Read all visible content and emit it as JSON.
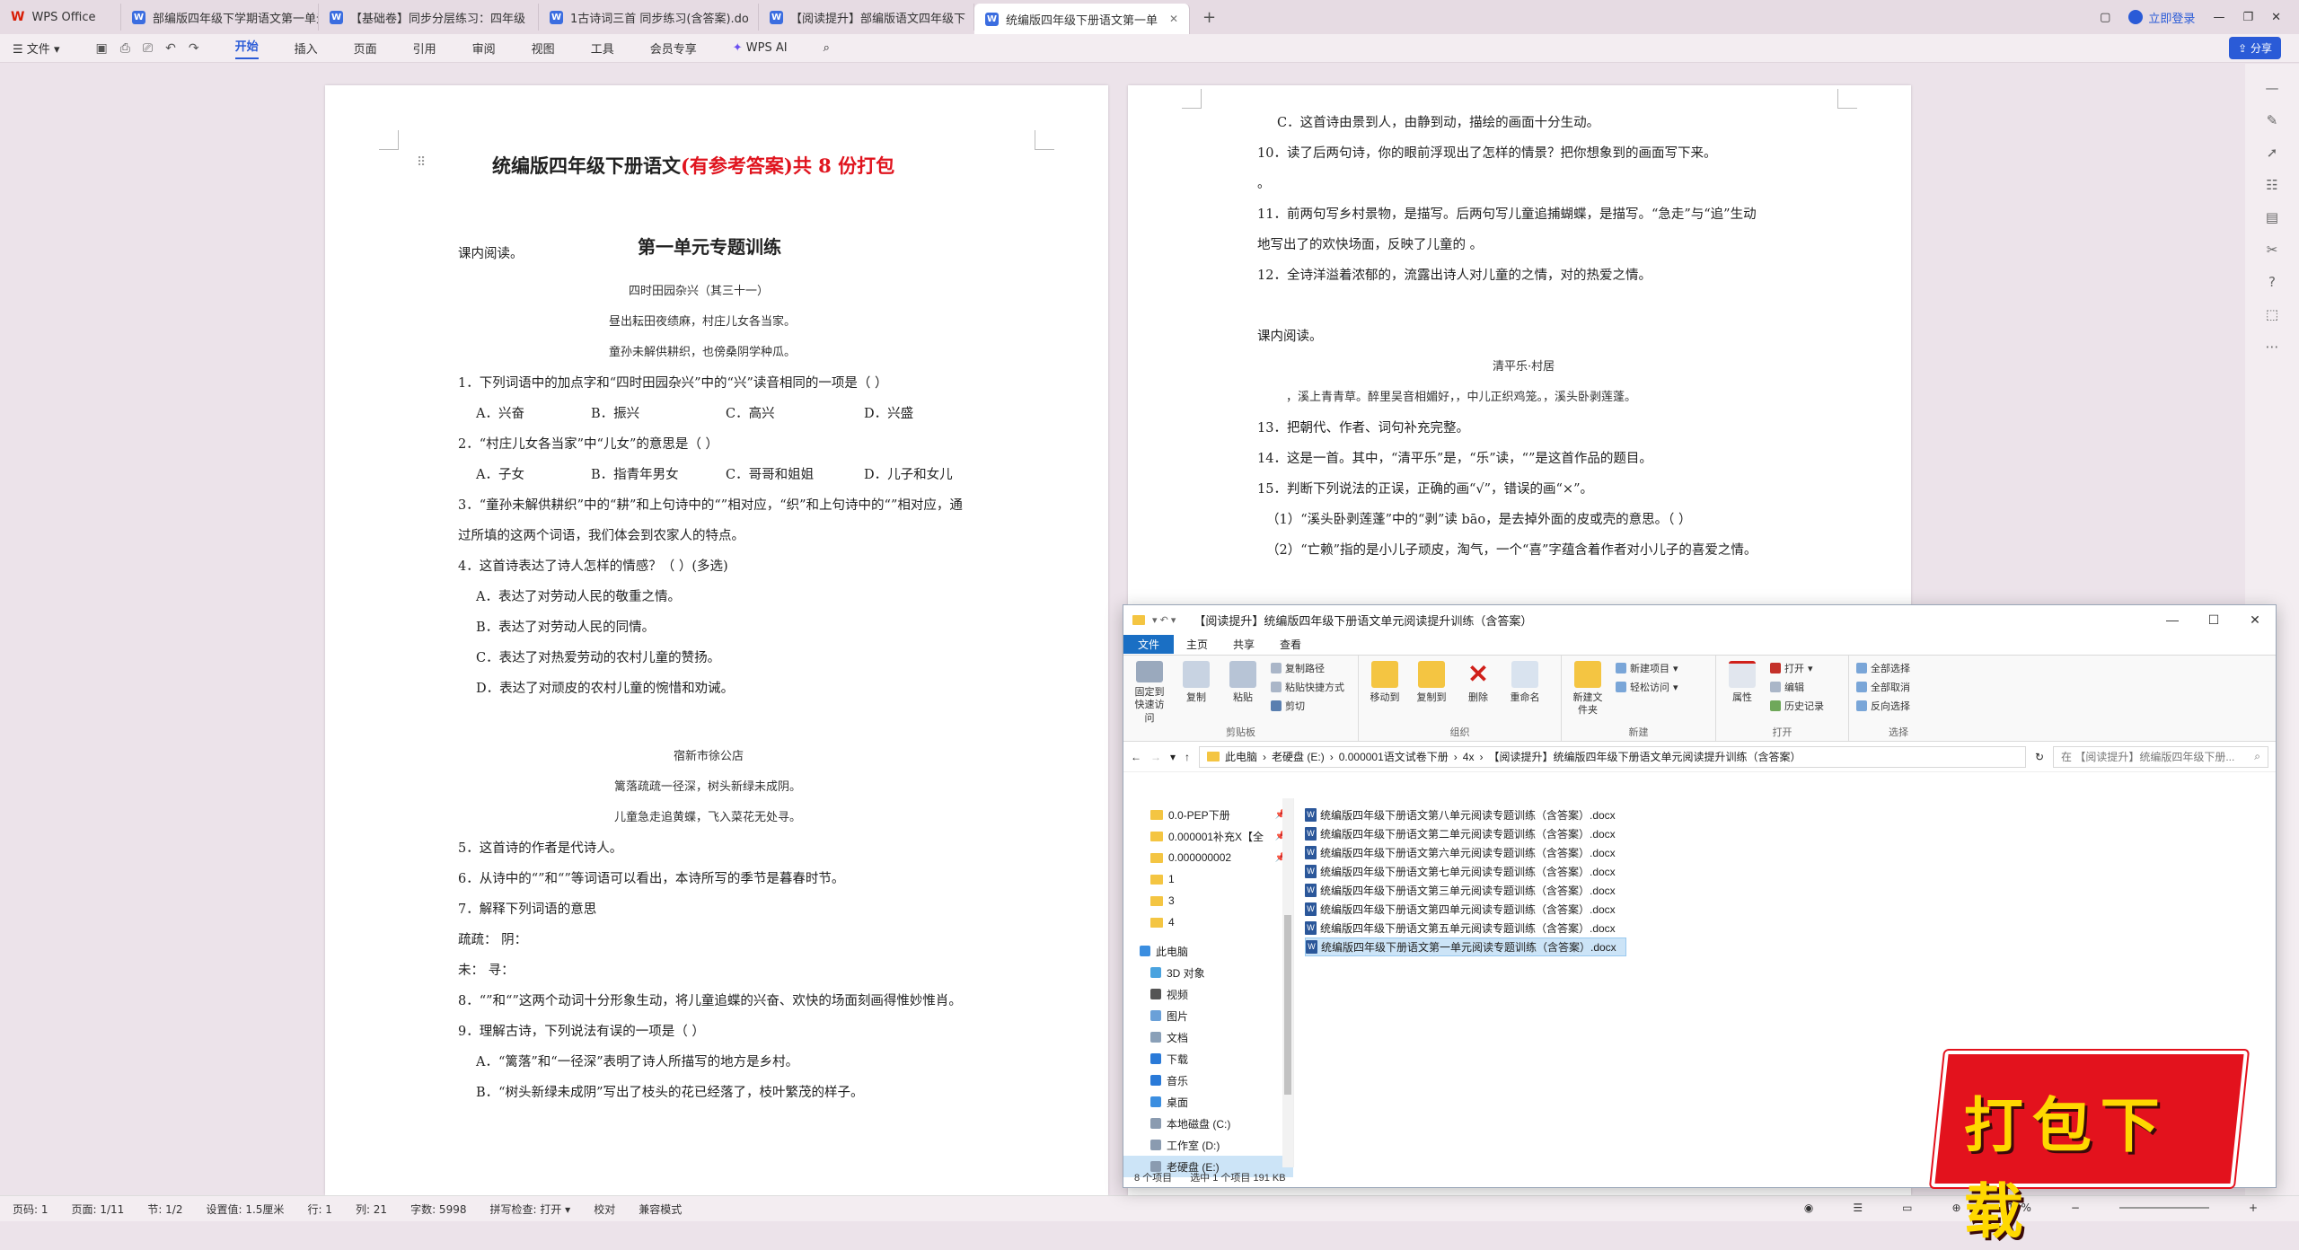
{
  "tabs": [
    {
      "label": "WPS Office",
      "type": "home"
    },
    {
      "label": "部编版四年级下学期语文第一单元",
      "type": "doc"
    },
    {
      "label": "【基础卷】同步分层练习：四年级",
      "type": "doc"
    },
    {
      "label": "1古诗词三首 同步练习(含答案).do",
      "type": "doc"
    },
    {
      "label": "【阅读提升】部编版语文四年级下",
      "type": "doc"
    },
    {
      "label": "统编版四年级下册语文第一单",
      "type": "doc",
      "active": true
    }
  ],
  "login": "立即登录",
  "menu": {
    "file": "文件",
    "items": [
      "开始",
      "插入",
      "页面",
      "引用",
      "审阅",
      "视图",
      "工具",
      "会员专享"
    ],
    "ai": "WPS AI",
    "share": "分享"
  },
  "page1": {
    "title_black": "统编版四年级下册语文",
    "title_red": "(有参考答案)共 8 份打包",
    "section": "第一单元专题训练",
    "lines": [
      "课内阅读。",
      "四时田园杂兴（其三十一）",
      "昼出耘田夜绩麻，村庄儿女各当家。",
      "童孙未解供耕织，也傍桑阴学种瓜。",
      "1．下列词语中的加点字和“四时田园杂兴”中的“兴”读音相同的一项是（    ）",
      "A．兴奋",
      "B．振兴",
      "C．高兴",
      "D．兴盛",
      "2．“村庄儿女各当家”中“儿女”的意思是（      ）",
      "A．子女",
      "B．指青年男女",
      "C．哥哥和姐姐",
      "D．儿子和女儿",
      "3．“童孙未解供耕织”中的“耕”和上句诗中的“”相对应，“织”和上句诗中的“”相对应，通",
      "过所填的这两个词语，我们体会到农家人的特点。",
      "4．这首诗表达了诗人怎样的情感？（        ）(多选)",
      "A．表达了对劳动人民的敬重之情。",
      "B．表达了对劳动人民的同情。",
      "C．表达了对热爱劳动的农村儿童的赞扬。",
      "D．表达了对顽皮的农村儿童的惋惜和劝诫。",
      "宿新市徐公店",
      "篱落疏疏一径深，树头新绿未成阴。",
      "儿童急走追黄蝶，飞入菜花无处寻。",
      "5．这首诗的作者是代诗人。",
      "6．从诗中的“”和“”等词语可以看出，本诗所写的季节是暮春时节。",
      "7．解释下列词语的意思",
      "疏疏：      阴：",
      "未：        寻：",
      "8．“”和“”这两个动词十分形象生动，将儿童追蝶的兴奋、欢快的场面刻画得惟妙惟肖。",
      "9．理解古诗，下列说法有误的一项是（    ）",
      "A．“篱落”和“一径深”表明了诗人所描写的地方是乡村。",
      "B．“树头新绿未成阴”写出了枝头的花已经落了，枝叶繁茂的样子。"
    ]
  },
  "page2": {
    "lines": [
      "C．这首诗由景到人，由静到动，描绘的画面十分生动。",
      "10．读了后两句诗，你的眼前浮现出了怎样的情景？把你想象到的画面写下来。",
      "。",
      "11．前两句写乡村景物，是描写。后两句写儿童追捕蝴蝶，是描写。“急走”与“追”生动",
      "地写出了的欢快场面，反映了儿童的 。",
      "12．全诗洋溢着浓郁的，流露出诗人对儿童的之情，对的热爱之情。",
      "课内阅读。",
      "清平乐·村居",
      "，溪上青青草。醉里吴音相媚好，，中儿正织鸡笼。，溪头卧剥莲蓬。",
      "13．把朝代、作者、词句补充完整。",
      "14．这是一首。其中，“清平乐”是，“乐”读，“”是这首作品的题目。",
      "15．判断下列说法的正误，正确的画“√”，错误的画“×”。",
      "（1）“溪头卧剥莲蓬”中的“剥”读 bāo，是去掉外面的皮或壳的意思。（     ）",
      "（2）“亡赖”指的是小儿子顽皮，淘气，一个“喜”字蕴含着作者对小儿子的喜爱之情。"
    ]
  },
  "explorer": {
    "title": "【阅读提升】统编版四年级下册语文单元阅读提升训练（含答案）",
    "ribbon_tabs": [
      "文件",
      "主页",
      "共享",
      "查看"
    ],
    "groups": {
      "clipboard": {
        "label": "剪贴板",
        "pin": "固定到快速访问",
        "copy": "复制",
        "paste": "粘贴",
        "copy_path": "复制路径",
        "paste_shortcut": "粘贴快捷方式",
        "cut": "剪切"
      },
      "organize": {
        "label": "组织",
        "move": "移动到",
        "copyto": "复制到",
        "delete": "删除",
        "rename": "重命名"
      },
      "new": {
        "label": "新建",
        "folder": "新建文件夹",
        "item": "新建项目",
        "easy": "轻松访问"
      },
      "open": {
        "label": "打开",
        "props": "属性",
        "open": "打开",
        "edit": "编辑",
        "history": "历史记录"
      },
      "select": {
        "label": "选择",
        "all": "全部选择",
        "none": "全部取消",
        "invert": "反向选择"
      }
    },
    "address": [
      "此电脑",
      "老硬盘 (E:)",
      "0.000001语文试卷下册",
      "4x",
      "【阅读提升】统编版四年级下册语文单元阅读提升训练（含答案）"
    ],
    "search_placeholder": "在 【阅读提升】统编版四年级下册...",
    "nav": [
      {
        "label": "0.0-PEP下册",
        "pin": true
      },
      {
        "label": "0.000001补充X【全",
        "pin": true
      },
      {
        "label": "0.000000002",
        "pin": true
      },
      {
        "label": "1"
      },
      {
        "label": "3"
      },
      {
        "label": "4"
      },
      {
        "label": "此电脑",
        "pc": true
      },
      {
        "label": "3D 对象"
      },
      {
        "label": "视频"
      },
      {
        "label": "图片"
      },
      {
        "label": "文档"
      },
      {
        "label": "下载"
      },
      {
        "label": "音乐"
      },
      {
        "label": "桌面"
      },
      {
        "label": "本地磁盘 (C:)"
      },
      {
        "label": "工作室 (D:)"
      },
      {
        "label": "老硬盘 (E:)",
        "sel": true
      }
    ],
    "files": [
      "统编版四年级下册语文第八单元阅读专题训练（含答案）.docx",
      "统编版四年级下册语文第二单元阅读专题训练（含答案）.docx",
      "统编版四年级下册语文第六单元阅读专题训练（含答案）.docx",
      "统编版四年级下册语文第七单元阅读专题训练（含答案）.docx",
      "统编版四年级下册语文第三单元阅读专题训练（含答案）.docx",
      "统编版四年级下册语文第四单元阅读专题训练（含答案）.docx",
      "统编版四年级下册语文第五单元阅读专题训练（含答案）.docx",
      "统编版四年级下册语文第一单元阅读专题训练（含答案）.docx"
    ],
    "status": {
      "count": "8 个项目",
      "selected": "选中 1 个项目  191 KB"
    }
  },
  "statusbar": {
    "page": "页码: 1",
    "pages": "页面: 1/11",
    "section": "节: 1/2",
    "setting": "设置值: 1.5厘米",
    "row": "行: 1",
    "col": "列: 21",
    "words": "字数: 5998",
    "spell": "拼写检查: 打开 ▾",
    "proof": "校对",
    "compat": "兼容模式",
    "zoom": "110%"
  },
  "promo": "打包下载"
}
